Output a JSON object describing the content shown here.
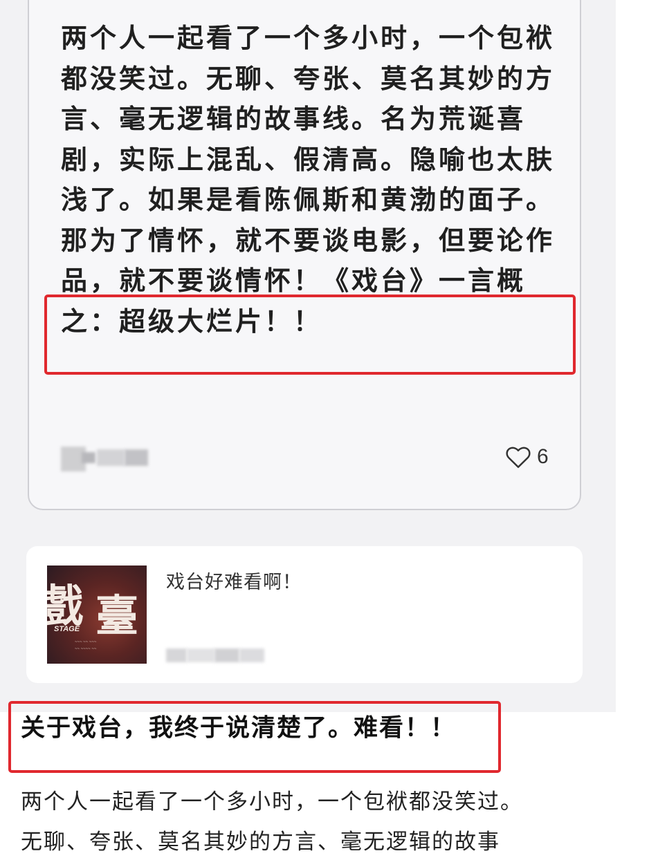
{
  "post": {
    "body": "两个人一起看了一个多小时，一个包袱都没笑过。无聊、夸张、莫名其妙的方言、毫无逻辑的故事线。名为荒诞喜剧，实际上混乱、假清高。隐喻也太肤浅了。如果是看陈佩斯和黄渤的面子。那为了情怀，就不要谈电影，但要论作品，就不要谈情怀！《戏台》一言概之：超级大烂片！！",
    "like_count": "6",
    "like_icon": "heart-icon"
  },
  "link_card": {
    "title": "戏台好难看啊！",
    "thumbnail_text": "戲臺",
    "thumbnail_sub": "STAGE"
  },
  "article": {
    "title": "关于戏台，我终于说清楚了。难看！！",
    "line1": "两个人一起看了一个多小时，一个包袱都没笑过。",
    "line2": "无聊、夸张、莫名其妙的方言、毫无逻辑的故事"
  },
  "colors": {
    "highlight": "#e0282e",
    "background": "#f2f2f4"
  }
}
